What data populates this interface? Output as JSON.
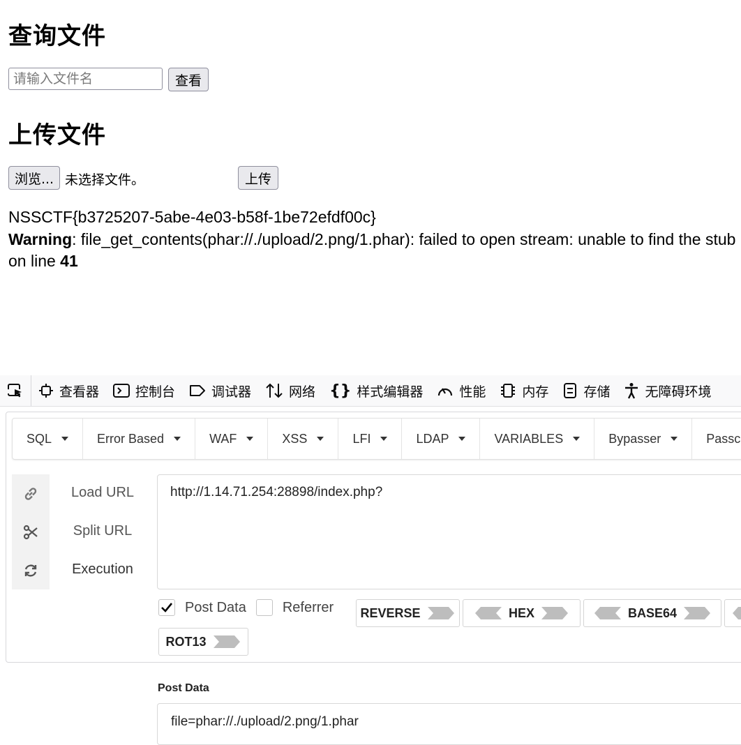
{
  "query": {
    "heading": "查询文件",
    "placeholder": "请输入文件名",
    "value": "",
    "button": "查看"
  },
  "upload": {
    "heading": "上传文件",
    "browse_button": "浏览...",
    "no_file": "未选择文件。",
    "upload_button": "上传"
  },
  "output": {
    "flag": "NSSCTF{b3725207-5abe-4e03-b58f-1be72efdf00c}",
    "warning_label": "Warning",
    "warning_text": ": file_get_contents(phar://./upload/2.png/1.phar): failed to open stream: unable to find the stub",
    "line_prefix": "on line ",
    "line_number": "41"
  },
  "devtools": {
    "tabs": [
      {
        "label": "查看器",
        "icon": "inspector-icon"
      },
      {
        "label": "控制台",
        "icon": "console-icon"
      },
      {
        "label": "调试器",
        "icon": "debugger-icon"
      },
      {
        "label": "网络",
        "icon": "network-icon"
      },
      {
        "label": "样式编辑器",
        "icon": "style-editor-icon"
      },
      {
        "label": "性能",
        "icon": "performance-icon"
      },
      {
        "label": "内存",
        "icon": "memory-icon"
      },
      {
        "label": "存储",
        "icon": "storage-icon"
      },
      {
        "label": "无障碍环境",
        "icon": "accessibility-icon"
      }
    ]
  },
  "hackbar": {
    "menu": [
      "SQL",
      "Error Based",
      "WAF",
      "XSS",
      "LFI",
      "LDAP",
      "VARIABLES",
      "Bypasser",
      "Passcode"
    ],
    "actions": {
      "load": "Load URL",
      "split": "Split URL",
      "execute": "Execution"
    },
    "url": "http://1.14.71.254:28898/index.php?",
    "post_data_checkbox": {
      "label": "Post Data",
      "checked": true
    },
    "referrer_checkbox": {
      "label": "Referrer",
      "checked": false
    },
    "encoders": [
      "REVERSE",
      "HEX",
      "BASE64",
      "ROT13"
    ],
    "post_label": "Post Data",
    "post_value": "file=phar://./upload/2.png/1.phar"
  },
  "colors": {
    "button_bg": "#e9e9ed",
    "toolbar_bg": "#f9f9fa",
    "arrow_gray": "#bdbdbd"
  }
}
